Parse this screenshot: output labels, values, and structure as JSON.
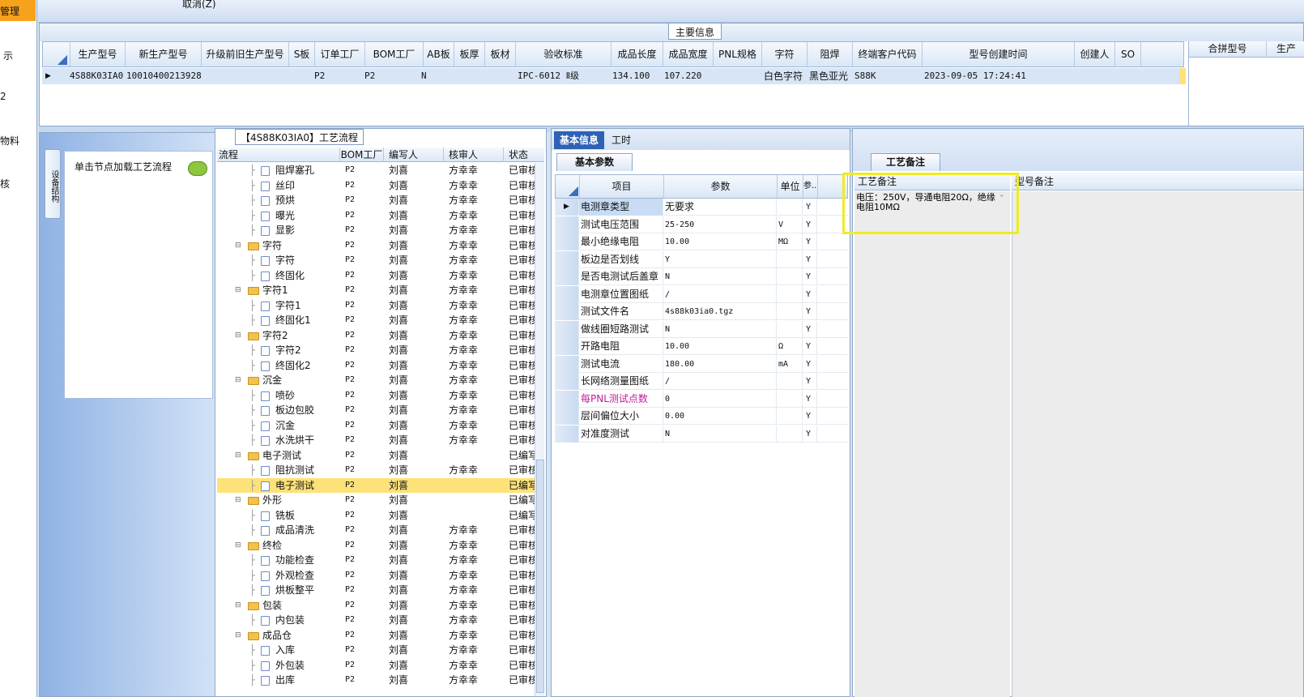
{
  "left_nav": {
    "items": [
      "管理",
      "示",
      "2",
      "物料",
      "核"
    ]
  },
  "top_strip": {
    "cancel_label": "取消(Z)"
  },
  "main_info": {
    "title": "主要信息",
    "columns": [
      "生产型号",
      "新生产型号",
      "升级前旧生产型号",
      "S板",
      "订单工厂",
      "BOM工厂",
      "AB板",
      "板厚",
      "板材",
      "验收标准",
      "成品长度",
      "成品宽度",
      "PNL规格",
      "字符",
      "阻焊",
      "终端客户代码",
      "型号创建时间",
      "创建人",
      "SO"
    ],
    "row": {
      "prod_model": "4S88K03IA0",
      "new_prod_model": "10010400213928",
      "order_factory": "P2",
      "bom_factory": "P2",
      "ab_board": "N",
      "standard": "IPC-6012 Ⅱ级",
      "length": "134.100",
      "width": "107.220",
      "char": "白色字符",
      "solder": "黑色亚光",
      "customer_code": "S88K",
      "created": "2023-09-05 17:24:41"
    },
    "right_columns": [
      "合拼型号",
      "生产"
    ]
  },
  "flow": {
    "title": "【4S88K03IA0】工艺流程",
    "columns": [
      "流程",
      "BOM工厂",
      "编写人",
      "核审人",
      "状态"
    ],
    "rows": [
      {
        "name": "阻焊塞孔",
        "type": "doc",
        "bom": "P2",
        "writer": "刘喜",
        "reviewer": "方幸幸",
        "status": "已审核"
      },
      {
        "name": "丝印",
        "type": "doc",
        "bom": "P2",
        "writer": "刘喜",
        "reviewer": "方幸幸",
        "status": "已审核"
      },
      {
        "name": "预烘",
        "type": "doc",
        "bom": "P2",
        "writer": "刘喜",
        "reviewer": "方幸幸",
        "status": "已审核"
      },
      {
        "name": "曝光",
        "type": "doc",
        "bom": "P2",
        "writer": "刘喜",
        "reviewer": "方幸幸",
        "status": "已审核"
      },
      {
        "name": "显影",
        "type": "doc",
        "bom": "P2",
        "writer": "刘喜",
        "reviewer": "方幸幸",
        "status": "已审核"
      },
      {
        "name": "字符",
        "type": "folder",
        "bom": "P2",
        "writer": "刘喜",
        "reviewer": "方幸幸",
        "status": "已审核"
      },
      {
        "name": "字符",
        "type": "doc",
        "bom": "P2",
        "writer": "刘喜",
        "reviewer": "方幸幸",
        "status": "已审核"
      },
      {
        "name": "终固化",
        "type": "doc",
        "bom": "P2",
        "writer": "刘喜",
        "reviewer": "方幸幸",
        "status": "已审核"
      },
      {
        "name": "字符1",
        "type": "folder",
        "bom": "P2",
        "writer": "刘喜",
        "reviewer": "方幸幸",
        "status": "已审核"
      },
      {
        "name": "字符1",
        "type": "doc",
        "bom": "P2",
        "writer": "刘喜",
        "reviewer": "方幸幸",
        "status": "已审核"
      },
      {
        "name": "终固化1",
        "type": "doc",
        "bom": "P2",
        "writer": "刘喜",
        "reviewer": "方幸幸",
        "status": "已审核"
      },
      {
        "name": "字符2",
        "type": "folder",
        "bom": "P2",
        "writer": "刘喜",
        "reviewer": "方幸幸",
        "status": "已审核"
      },
      {
        "name": "字符2",
        "type": "doc",
        "bom": "P2",
        "writer": "刘喜",
        "reviewer": "方幸幸",
        "status": "已审核"
      },
      {
        "name": "终固化2",
        "type": "doc",
        "bom": "P2",
        "writer": "刘喜",
        "reviewer": "方幸幸",
        "status": "已审核"
      },
      {
        "name": "沉金",
        "type": "folder",
        "bom": "P2",
        "writer": "刘喜",
        "reviewer": "方幸幸",
        "status": "已审核"
      },
      {
        "name": "喷砂",
        "type": "doc",
        "bom": "P2",
        "writer": "刘喜",
        "reviewer": "方幸幸",
        "status": "已审核"
      },
      {
        "name": "板边包胶",
        "type": "doc",
        "bom": "P2",
        "writer": "刘喜",
        "reviewer": "方幸幸",
        "status": "已审核"
      },
      {
        "name": "沉金",
        "type": "doc",
        "bom": "P2",
        "writer": "刘喜",
        "reviewer": "方幸幸",
        "status": "已审核"
      },
      {
        "name": "水洗烘干",
        "type": "doc",
        "bom": "P2",
        "writer": "刘喜",
        "reviewer": "方幸幸",
        "status": "已审核"
      },
      {
        "name": "电子测试",
        "type": "folder",
        "bom": "P2",
        "writer": "刘喜",
        "reviewer": "",
        "status": "已编写"
      },
      {
        "name": "阻抗测试",
        "type": "doc",
        "bom": "P2",
        "writer": "刘喜",
        "reviewer": "方幸幸",
        "status": "已审核"
      },
      {
        "name": "电子测试",
        "type": "doc",
        "bom": "P2",
        "writer": "刘喜",
        "reviewer": "",
        "status": "已编写",
        "selected": true
      },
      {
        "name": "外形",
        "type": "folder",
        "bom": "P2",
        "writer": "刘喜",
        "reviewer": "",
        "status": "已编写"
      },
      {
        "name": "铣板",
        "type": "doc",
        "bom": "P2",
        "writer": "刘喜",
        "reviewer": "",
        "status": "已编写"
      },
      {
        "name": "成品清洗",
        "type": "doc",
        "bom": "P2",
        "writer": "刘喜",
        "reviewer": "方幸幸",
        "status": "已审核"
      },
      {
        "name": "终检",
        "type": "folder",
        "bom": "P2",
        "writer": "刘喜",
        "reviewer": "方幸幸",
        "status": "已审核"
      },
      {
        "name": "功能检查",
        "type": "doc",
        "bom": "P2",
        "writer": "刘喜",
        "reviewer": "方幸幸",
        "status": "已审核"
      },
      {
        "name": "外观检查",
        "type": "doc",
        "bom": "P2",
        "writer": "刘喜",
        "reviewer": "方幸幸",
        "status": "已审核"
      },
      {
        "name": "烘板整平",
        "type": "doc",
        "bom": "P2",
        "writer": "刘喜",
        "reviewer": "方幸幸",
        "status": "已审核"
      },
      {
        "name": "包装",
        "type": "folder",
        "bom": "P2",
        "writer": "刘喜",
        "reviewer": "方幸幸",
        "status": "已审核"
      },
      {
        "name": "内包装",
        "type": "doc",
        "bom": "P2",
        "writer": "刘喜",
        "reviewer": "方幸幸",
        "status": "已审核"
      },
      {
        "name": "成品仓",
        "type": "folder",
        "bom": "P2",
        "writer": "刘喜",
        "reviewer": "方幸幸",
        "status": "已审核"
      },
      {
        "name": "入库",
        "type": "doc",
        "bom": "P2",
        "writer": "刘喜",
        "reviewer": "方幸幸",
        "status": "已审核"
      },
      {
        "name": "外包装",
        "type": "doc",
        "bom": "P2",
        "writer": "刘喜",
        "reviewer": "方幸幸",
        "status": "已审核"
      },
      {
        "name": "出库",
        "type": "doc",
        "bom": "P2",
        "writer": "刘喜",
        "reviewer": "方幸幸",
        "status": "已审核"
      }
    ]
  },
  "left_tabs": {
    "vertical_tab": "设备结构",
    "load_label": "单击节点加载工艺流程"
  },
  "basic": {
    "tab_basic": "基本信息",
    "tab_hours": "工时",
    "param_tab": "基本参数",
    "columns": [
      "项目",
      "参数",
      "单位",
      "参..."
    ],
    "rows": [
      {
        "item": "电测章类型",
        "value": "无要求",
        "unit": "",
        "flag": "Y"
      },
      {
        "item": "测试电压范围",
        "value": "25-250",
        "unit": "V",
        "flag": "Y"
      },
      {
        "item": "最小绝缘电阻",
        "value": "10.00",
        "unit": "MΩ",
        "flag": "Y"
      },
      {
        "item": "板边是否划线",
        "value": "Y",
        "unit": "",
        "flag": "Y"
      },
      {
        "item": "是否电测试后盖章",
        "value": "N",
        "unit": "",
        "flag": "Y"
      },
      {
        "item": "电测章位置图纸",
        "value": "/",
        "unit": "",
        "flag": "Y"
      },
      {
        "item": "测试文件名",
        "value": "4s88k03ia0.tgz",
        "unit": "",
        "flag": "Y"
      },
      {
        "item": "做线圈短路测试",
        "value": "N",
        "unit": "",
        "flag": "Y"
      },
      {
        "item": "开路电阻",
        "value": "10.00",
        "unit": "Ω",
        "flag": "Y"
      },
      {
        "item": "测试电流",
        "value": "180.00",
        "unit": "mA",
        "flag": "Y"
      },
      {
        "item": "长网络测量图纸",
        "value": "/",
        "unit": "",
        "flag": "Y"
      },
      {
        "item": "每PNL测试点数",
        "value": "0",
        "unit": "",
        "flag": "Y",
        "highlight": true
      },
      {
        "item": "层间偏位大小",
        "value": "0.00",
        "unit": "",
        "flag": "Y"
      },
      {
        "item": "对准度测试",
        "value": "N",
        "unit": "",
        "flag": "Y"
      }
    ]
  },
  "remarks": {
    "tab_label": "工艺备注",
    "col1": "工艺备注",
    "col2": "型号备注",
    "text": "电压：250V，导通电阻20Ω，绝缘电阻10MΩ"
  },
  "colors": {
    "selection": "#fde27a",
    "accent_tab": "#2f62b6",
    "nav_selected": "#f7a21b",
    "highlight_box": "#f0ec22",
    "pink_label": "#c0209a"
  }
}
